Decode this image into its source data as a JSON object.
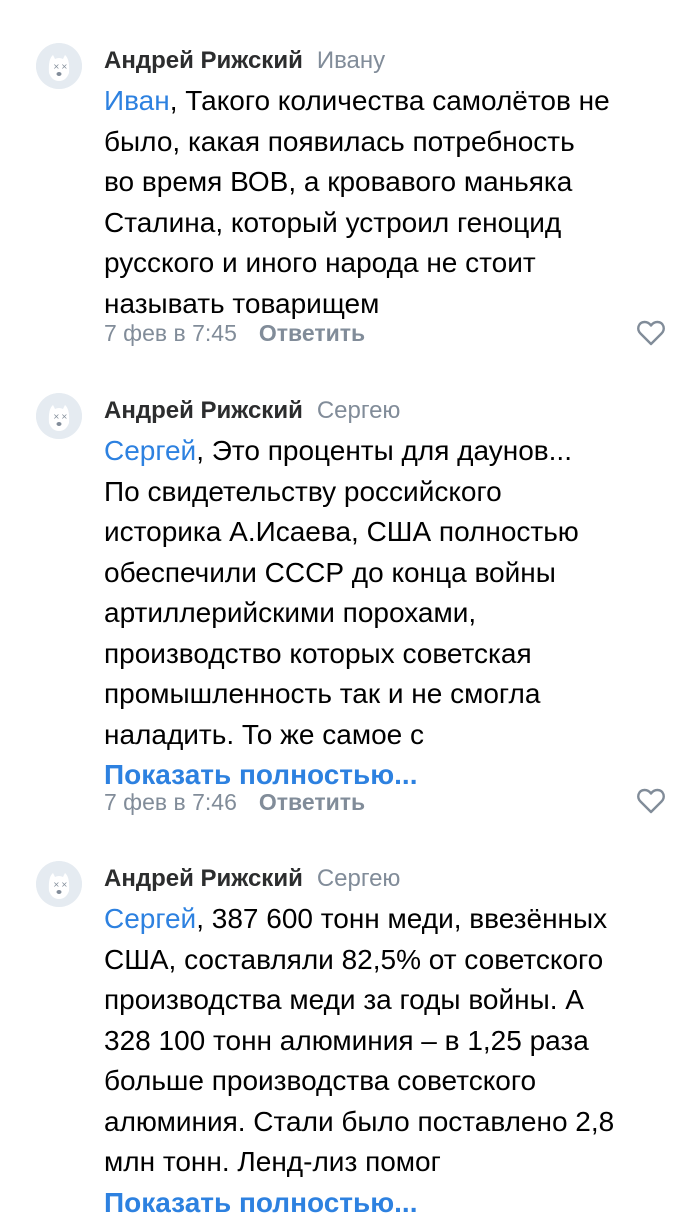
{
  "comments": [
    {
      "author": "Андрей Рижский",
      "reply_to": "Ивану",
      "mention": "Иван",
      "first_line_rest": ", Такого количества самолётов не",
      "lines": [
        "было, какая появилась потребность",
        "во время ВОВ, а кровавого маньяка",
        "Сталина, который устроил геноцид",
        "русского и иного народа не стоит",
        "называть товарищем"
      ],
      "show_more": "",
      "date": "7 фев в 7:45",
      "reply_label": "Ответить"
    },
    {
      "author": "Андрей Рижский",
      "reply_to": "Сергею",
      "mention": "Сергей",
      "first_line_rest": ", Это проценты для даунов...",
      "lines": [
        "По свидетельству российского",
        "историка А.Исаева, США полностью",
        "обеспечили СССР до конца войны",
        "артиллерийскими порохами,",
        "производство которых советская",
        "промышленность так и не смогла",
        "наладить. То же самое с"
      ],
      "show_more": "Показать полностью...",
      "date": "7 фев в 7:46",
      "reply_label": "Ответить"
    },
    {
      "author": "Андрей Рижский",
      "reply_to": "Сергею",
      "mention": "Сергей",
      "first_line_rest": ", 387 600 тонн меди, ввезённых",
      "lines": [
        "США, составляли 82,5% от советского",
        "производства меди за годы войны. А",
        "328 100 тонн алюминия – в 1,25 раза",
        "больше производства советского",
        "алюминия. Стали было поставлено 2,8",
        "млн тонн. Ленд-лиз помог"
      ],
      "show_more": "Показать полностью...",
      "date": "",
      "reply_label": ""
    }
  ],
  "colors": {
    "link": "#2d81e0",
    "secondary": "#818c99",
    "avatar_bg": "#e5ebf1"
  },
  "icons": {
    "avatar": "deactivated-dog-avatar-icon",
    "like": "heart-outline-icon"
  }
}
